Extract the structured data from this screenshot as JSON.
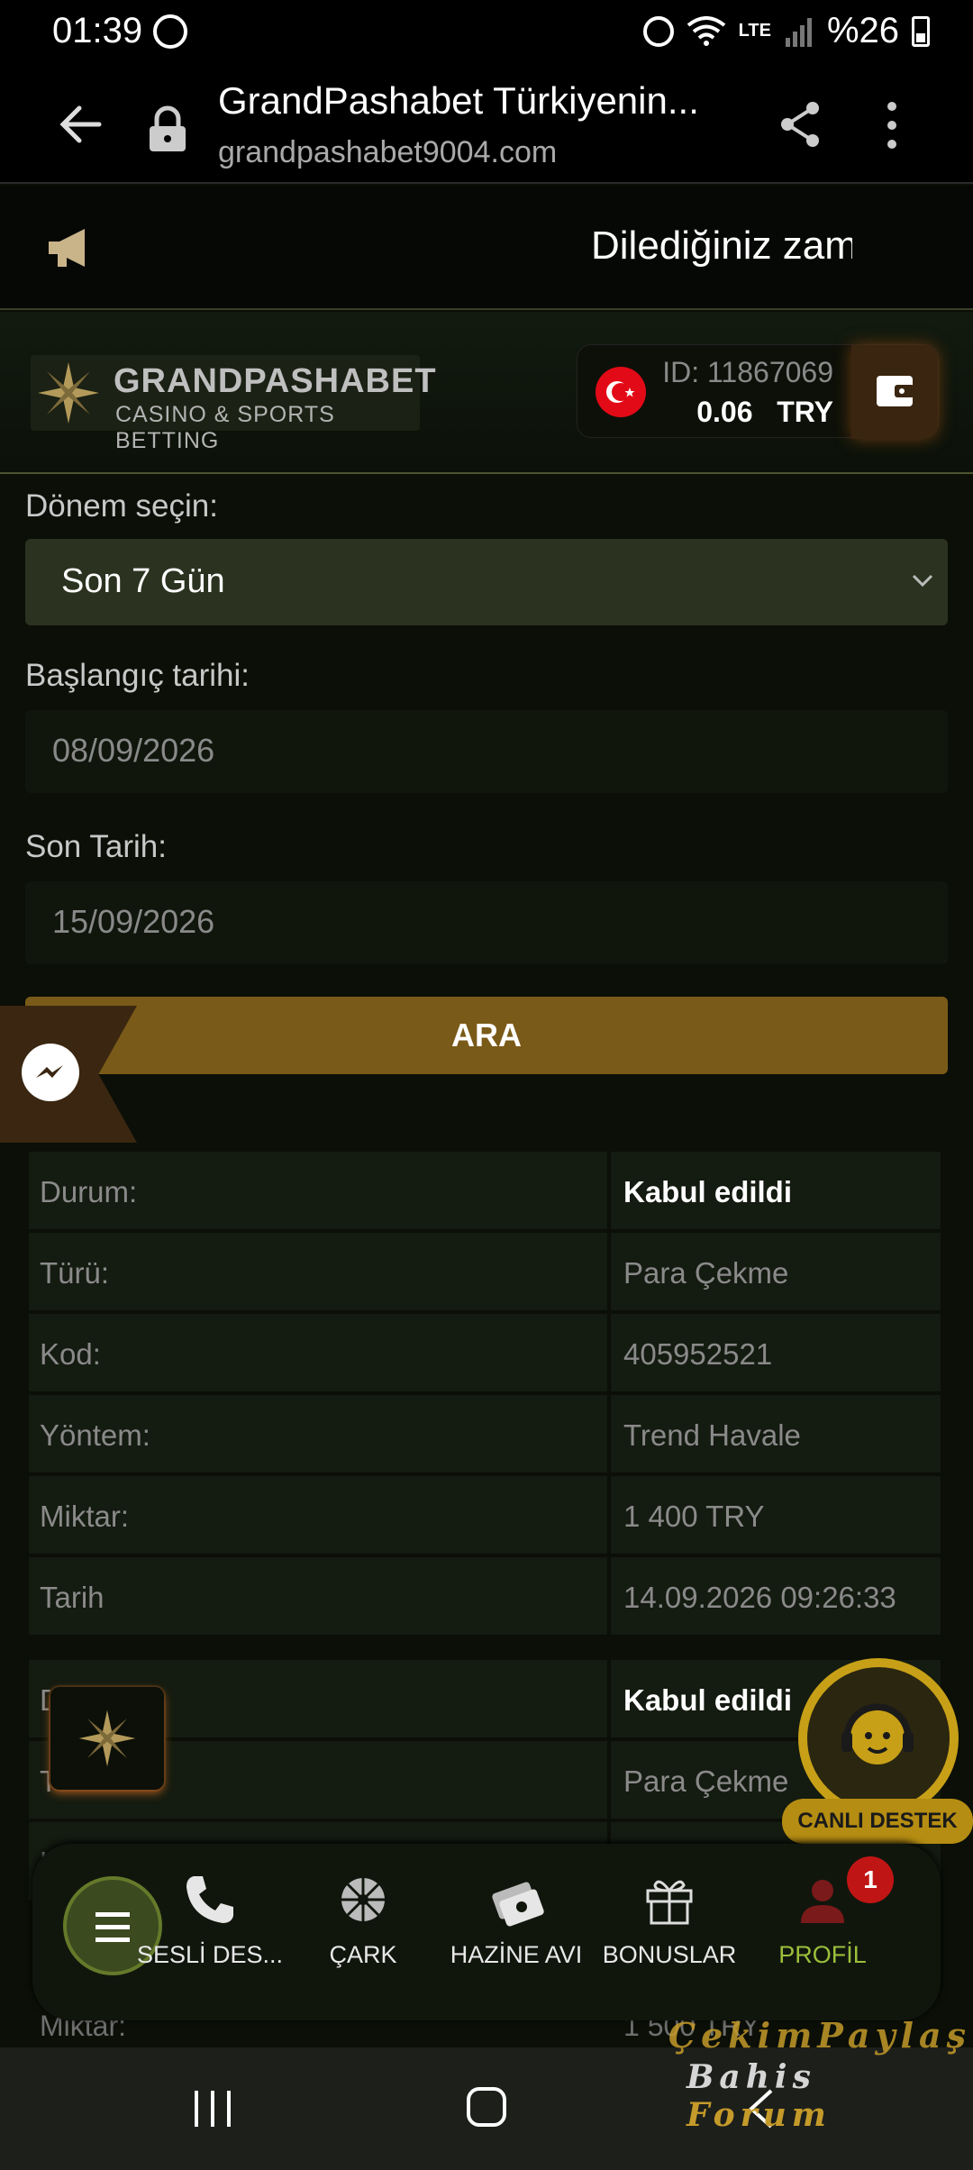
{
  "status_bar": {
    "time": "01:39",
    "battery": "%26",
    "network": "LTE"
  },
  "browser": {
    "title": "GrandPashabet Türkiyenin...",
    "url": "grandpashabet9004.com"
  },
  "announcement": {
    "marquee_text": "Dilediğiniz zam"
  },
  "brand": {
    "name": "GRANDPASHABET",
    "tagline": "CASINO & SPORTS BETTING"
  },
  "account": {
    "id": "ID: 11867069",
    "balance": "0.06",
    "currency": "TRY"
  },
  "form": {
    "period_label": "Dönem seçin:",
    "period_value": "Son 7 Gün",
    "start_label": "Başlangıç tarihi:",
    "start_value": "08/09/2026",
    "end_label": "Son Tarih:",
    "end_value": "15/09/2026",
    "search_button": "ARA"
  },
  "transactions": [
    {
      "rows": [
        {
          "key": "Durum:",
          "value": "Kabul edildi",
          "bold": true
        },
        {
          "key": "Türü:",
          "value": "Para Çekme"
        },
        {
          "key": "Kod:",
          "value": "405952521"
        },
        {
          "key": "Yöntem:",
          "value": "Trend Havale"
        },
        {
          "key": "Miktar:",
          "value": "1 400 TRY"
        },
        {
          "key": "Tarih",
          "value": "14.09.2026 09:26:33"
        }
      ]
    },
    {
      "rows": [
        {
          "key": "D",
          "value": "Kabul edildi",
          "bold": true
        },
        {
          "key": "T",
          "value": "Para Çekme"
        },
        {
          "key": "K",
          "value": ""
        }
      ]
    }
  ],
  "peek_row": {
    "key": "Miktar:",
    "value": "1 500 TRY"
  },
  "live_support": {
    "label": "CANLI DESTEK"
  },
  "bottom_nav": {
    "items": [
      {
        "label": "SESLİ DES...",
        "icon": "phone-icon"
      },
      {
        "label": "ÇARK",
        "icon": "wheel-icon"
      },
      {
        "label": "HAZİNE AVI",
        "icon": "treasure-icon"
      },
      {
        "label": "BONUSLAR",
        "icon": "gift-icon"
      },
      {
        "label": "PROFİL",
        "icon": "profile-icon"
      }
    ],
    "notification_count": "1"
  },
  "watermark": {
    "line1": "ÇekimPaylaş",
    "line2a": "Bahis",
    "line2b": "Forum"
  },
  "colors": {
    "accent_gold": "#7a5a18",
    "select_bg": "#2b3320",
    "active_nav": "#9bbf3a",
    "badge_red": "#c01515"
  }
}
